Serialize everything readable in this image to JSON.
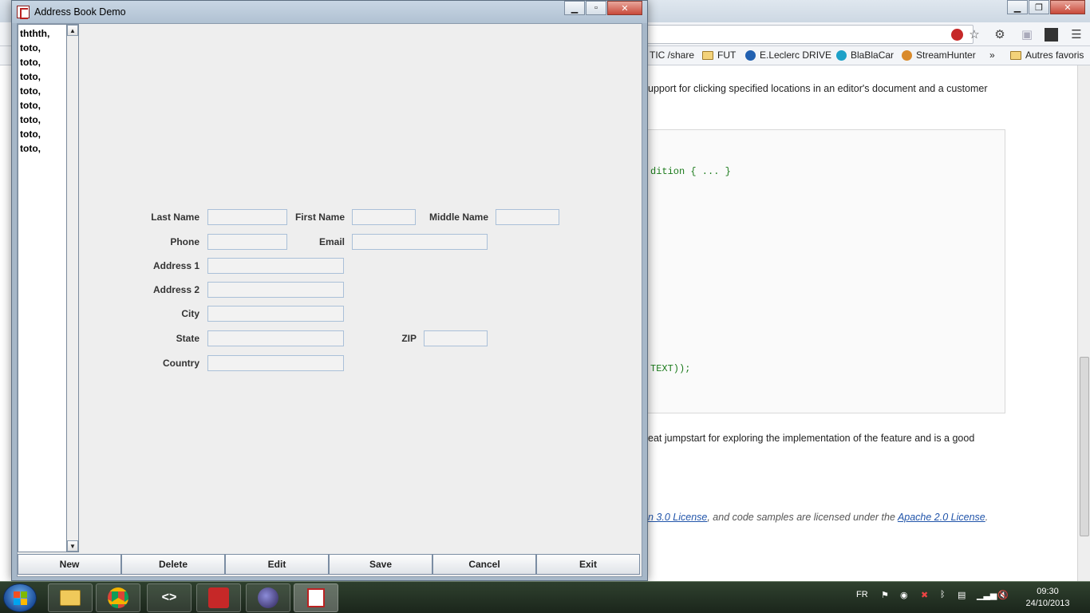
{
  "browser": {
    "bookmarks": [
      "TIC /share",
      "FUT",
      "E.Leclerc DRIVE",
      "BlaBlaCar",
      "StreamHunter",
      "»",
      "Autres favoris"
    ],
    "page_text_1": "upport for clicking specified locations in an editor's document and a customer",
    "code_line_1": "dition { ... }",
    "code_line_2": "TEXT));",
    "page_text_2": "eat jumpstart for exploring the implementation of the feature and is a good",
    "license_link_1": "n 3.0 License",
    "license_middle": ", and code samples are licensed under the ",
    "license_link_2": "Apache 2.0 License",
    "license_end": "."
  },
  "app": {
    "title": "Address Book Demo",
    "list_items": [
      "ththth,",
      "toto,",
      "toto,",
      "toto,",
      "toto,",
      "toto,",
      "toto,",
      "toto,",
      "toto,"
    ],
    "form": {
      "last_name_label": "Last Name",
      "first_name_label": "First Name",
      "middle_name_label": "Middle Name",
      "phone_label": "Phone",
      "email_label": "Email",
      "address1_label": "Address 1",
      "address2_label": "Address 2",
      "city_label": "City",
      "state_label": "State",
      "zip_label": "ZIP",
      "country_label": "Country"
    },
    "buttons": {
      "new": "New",
      "delete": "Delete",
      "edit": "Edit",
      "save": "Save",
      "cancel": "Cancel",
      "exit": "Exit"
    }
  },
  "taskbar": {
    "language": "FR",
    "time": "09:30",
    "date": "24/10/2013"
  }
}
